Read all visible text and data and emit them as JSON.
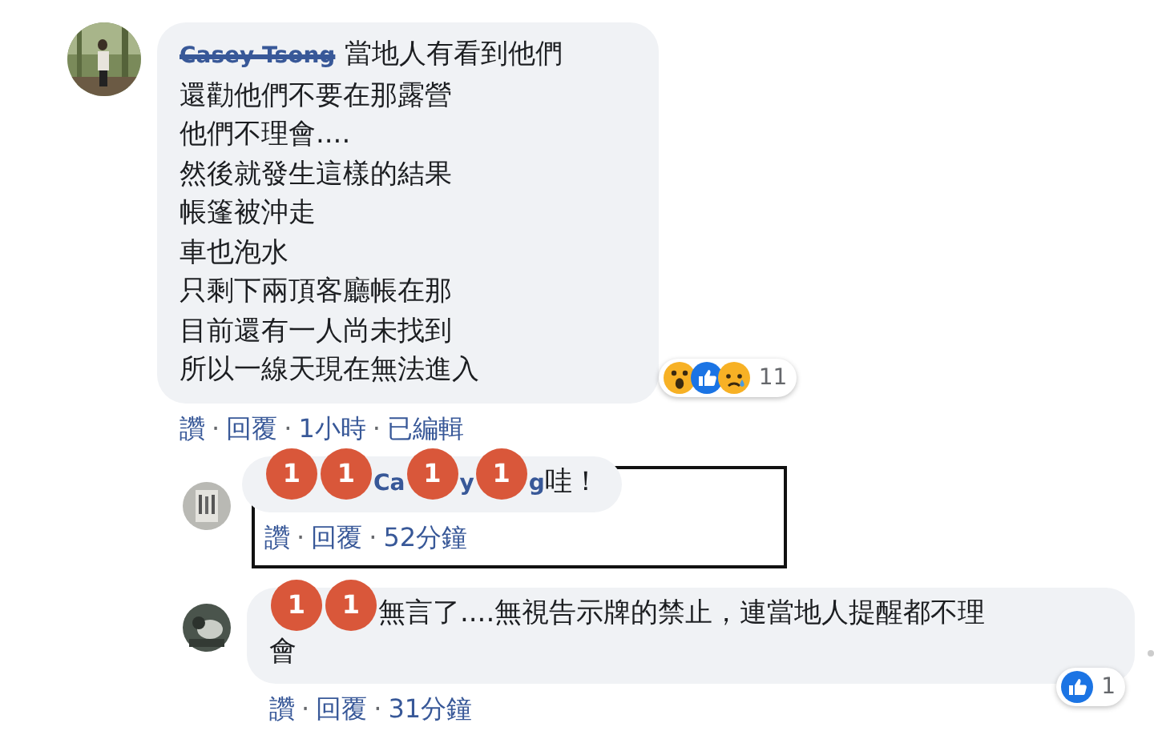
{
  "comments": [
    {
      "name": "Casey Tsong",
      "name_scribbled": true,
      "lines": [
        "當地人有看到他們",
        "還勸他們不要在那露營",
        "他們不理會....",
        "然後就發生這樣的結果",
        "帳篷被沖走",
        "車也泡水",
        "只剩下兩頂客廳帳在那",
        "目前還有一人尚未找到",
        "所以一線天現在無法進入"
      ],
      "reactions": {
        "icons": [
          {
            "kind": "wow"
          },
          {
            "kind": "like"
          },
          {
            "kind": "sad"
          }
        ],
        "count": "11"
      },
      "actions": [
        {
          "kind": "link",
          "text": "讚"
        },
        {
          "kind": "sep",
          "text": "·"
        },
        {
          "kind": "link",
          "text": "回覆"
        },
        {
          "kind": "sep",
          "text": "·"
        },
        {
          "kind": "time",
          "text": "1小時"
        },
        {
          "kind": "sep",
          "text": "·"
        },
        {
          "kind": "time",
          "text": "已編輯"
        }
      ],
      "replies": [
        {
          "highlighted": true,
          "segments": [
            {
              "kind": "badge",
              "text": "1"
            },
            {
              "kind": "badge",
              "text": "1"
            },
            {
              "kind": "name",
              "text": "Ca"
            },
            {
              "kind": "badge",
              "text": "1"
            },
            {
              "kind": "name",
              "text": "y"
            },
            {
              "kind": "badge",
              "text": "1"
            },
            {
              "kind": "name",
              "text": "g"
            },
            {
              "kind": "text",
              "text": "哇！"
            }
          ],
          "actions": [
            {
              "kind": "link",
              "text": "讚"
            },
            {
              "kind": "sep",
              "text": "·"
            },
            {
              "kind": "link",
              "text": "回覆"
            },
            {
              "kind": "sep",
              "text": "·"
            },
            {
              "kind": "time",
              "text": "52分鐘"
            }
          ]
        },
        {
          "highlighted": false,
          "segments": [
            {
              "kind": "badge",
              "text": "1"
            },
            {
              "kind": "badge",
              "text": "1"
            },
            {
              "kind": "text",
              "text": "無言了....無視告示牌的禁止，連當地人提醒都不理"
            },
            {
              "kind": "line",
              "text": "會"
            }
          ],
          "reactions": {
            "icons": [
              {
                "kind": "like"
              }
            ],
            "count": "1"
          },
          "actions": [
            {
              "kind": "link",
              "text": "讚"
            },
            {
              "kind": "sep",
              "text": "·"
            },
            {
              "kind": "link",
              "text": "回覆"
            },
            {
              "kind": "sep",
              "text": "·"
            },
            {
              "kind": "time",
              "text": "31分鐘"
            }
          ]
        }
      ]
    }
  ]
}
